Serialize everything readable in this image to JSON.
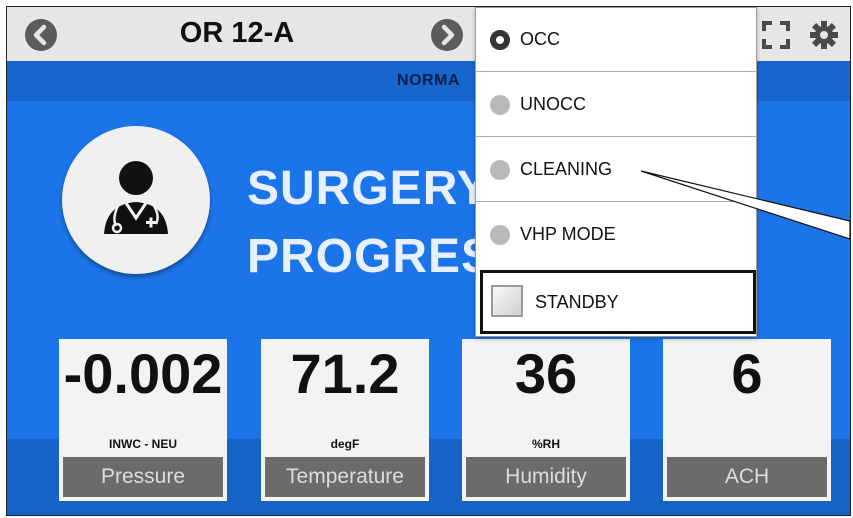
{
  "header": {
    "room": "OR 12-A",
    "prev_icon": "chevron-left-icon",
    "next_icon": "chevron-right-icon",
    "fullscreen_icon": "fullscreen-icon",
    "settings_icon": "gear-icon"
  },
  "status": {
    "text": "NORMA"
  },
  "mode": {
    "line1": "SURGERY",
    "line2": "PROGRES"
  },
  "avatar": {
    "icon": "doctor-icon"
  },
  "metrics": [
    {
      "value": "-0.002",
      "unit": "INWC - NEU",
      "label": "Pressure"
    },
    {
      "value": "71.2",
      "unit": "degF",
      "label": "Temperature"
    },
    {
      "value": "36",
      "unit": "%RH",
      "label": "Humidity"
    },
    {
      "value": "6",
      "unit": "",
      "label": "ACH"
    }
  ],
  "dropdown": {
    "options": [
      {
        "label": "OCC",
        "selected": true
      },
      {
        "label": "UNOCC",
        "selected": false
      },
      {
        "label": "CLEANING",
        "selected": false
      },
      {
        "label": "VHP MODE",
        "selected": false
      }
    ],
    "standby_label": "STANDBY",
    "standby_checked": false
  },
  "colors": {
    "main_blue": "#1c75e8",
    "status_blue": "#1766cf",
    "tile_label_gray": "#6b6b6b"
  }
}
